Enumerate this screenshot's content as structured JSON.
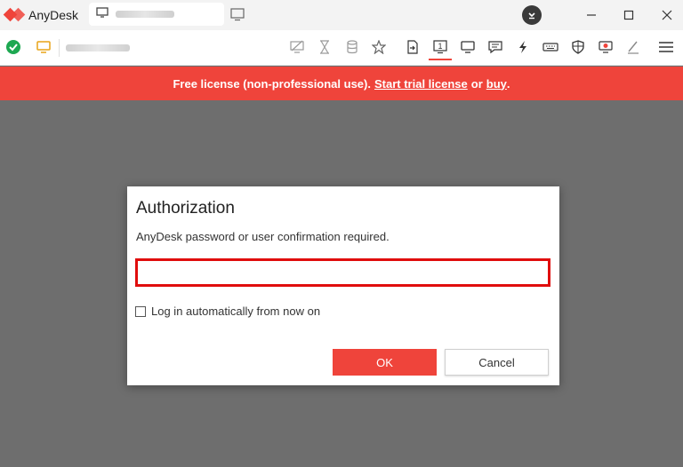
{
  "app": {
    "title": "AnyDesk"
  },
  "banner": {
    "prefix": "Free license (non-professional use).",
    "trial_link": "Start trial license",
    "or": "or",
    "buy_link": "buy",
    "suffix": "."
  },
  "dialog": {
    "title": "Authorization",
    "message": "AnyDesk password or user confirmation required.",
    "password_value": "",
    "auto_login_label": "Log in automatically from now on",
    "auto_login_checked": false,
    "ok_label": "OK",
    "cancel_label": "Cancel"
  },
  "colors": {
    "accent": "#ef443b",
    "input_border": "#e00d0d",
    "background": "#6e6e6e"
  },
  "icons": [
    "anydesk-logo-icon",
    "monitor-icon",
    "new-tab-icon",
    "download-icon",
    "minimize-icon",
    "maximize-icon",
    "close-icon",
    "connected-check-icon",
    "remote-monitor-icon",
    "privacy-icon",
    "hourglass-icon",
    "storage-icon",
    "favorite-icon",
    "file-transfer-icon",
    "display-1-icon",
    "screen-icon",
    "chat-icon",
    "actions-icon",
    "keyboard-icon",
    "shield-icon",
    "record-icon",
    "whiteboard-icon",
    "menu-icon"
  ]
}
